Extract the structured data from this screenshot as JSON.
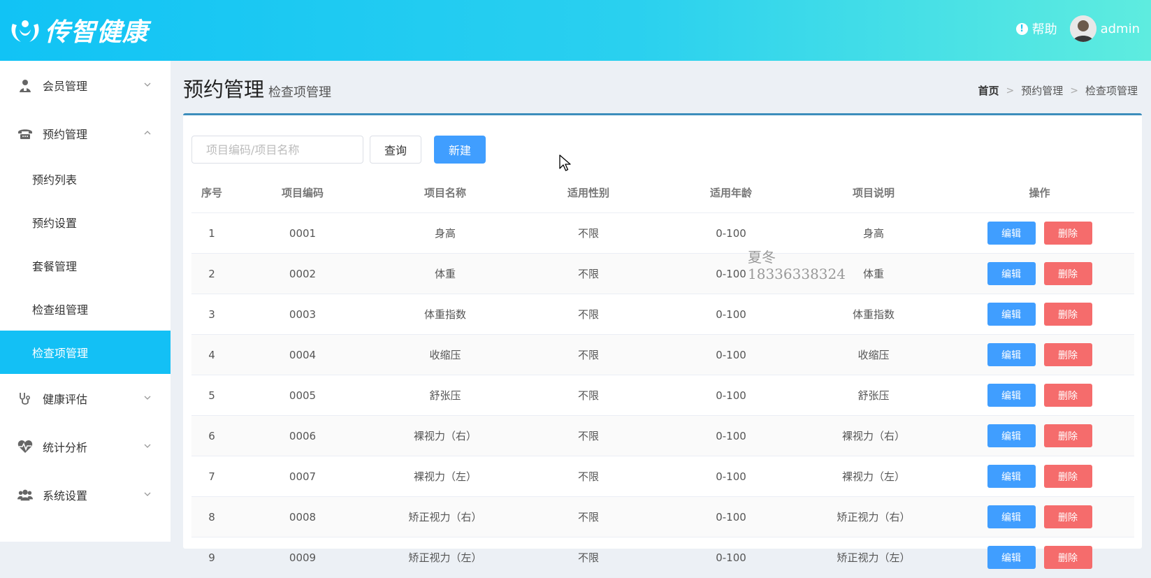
{
  "app": {
    "logo_text": "传智健康",
    "help_label": "帮助",
    "username": "admin"
  },
  "sidebar": {
    "items": [
      {
        "label": "会员管理",
        "icon": "user-icon",
        "expanded": false
      },
      {
        "label": "预约管理",
        "icon": "phone-icon",
        "expanded": true,
        "children": [
          "预约列表",
          "预约设置",
          "套餐管理",
          "检查组管理",
          "检查项管理"
        ],
        "active_child": "检查项管理"
      },
      {
        "label": "健康评估",
        "icon": "stethoscope-icon",
        "expanded": false
      },
      {
        "label": "统计分析",
        "icon": "heartbeat-icon",
        "expanded": false
      },
      {
        "label": "系统设置",
        "icon": "users-icon",
        "expanded": false
      }
    ]
  },
  "page": {
    "title": "预约管理",
    "subtitle": "检查项管理",
    "breadcrumb": [
      "首页",
      "预约管理",
      "检查项管理"
    ]
  },
  "toolbar": {
    "search_placeholder": "项目编码/项目名称",
    "search_value": "",
    "query_label": "查询",
    "new_label": "新建"
  },
  "table": {
    "columns": [
      "序号",
      "项目编码",
      "项目名称",
      "适用性别",
      "适用年龄",
      "项目说明",
      "操作"
    ],
    "edit_label": "编辑",
    "delete_label": "删除",
    "rows": [
      [
        "1",
        "0001",
        "身高",
        "不限",
        "0-100",
        "身高"
      ],
      [
        "2",
        "0002",
        "体重",
        "不限",
        "0-100",
        "体重"
      ],
      [
        "3",
        "0003",
        "体重指数",
        "不限",
        "0-100",
        "体重指数"
      ],
      [
        "4",
        "0004",
        "收缩压",
        "不限",
        "0-100",
        "收缩压"
      ],
      [
        "5",
        "0005",
        "舒张压",
        "不限",
        "0-100",
        "舒张压"
      ],
      [
        "6",
        "0006",
        "裸视力（右）",
        "不限",
        "0-100",
        "裸视力（右）"
      ],
      [
        "7",
        "0007",
        "裸视力（左）",
        "不限",
        "0-100",
        "裸视力（左）"
      ],
      [
        "8",
        "0008",
        "矫正视力（右）",
        "不限",
        "0-100",
        "矫正视力（右）"
      ],
      [
        "9",
        "0009",
        "矫正视力（左）",
        "不限",
        "0-100",
        "矫正视力（左）"
      ]
    ]
  },
  "watermark": {
    "name": "夏冬",
    "phone": "18336338324"
  },
  "colors": {
    "header_start": "#11c3f5",
    "header_end": "#5eecdf",
    "active_menu": "#13c0f5",
    "primary": "#409eff",
    "danger": "#f56c6c"
  }
}
